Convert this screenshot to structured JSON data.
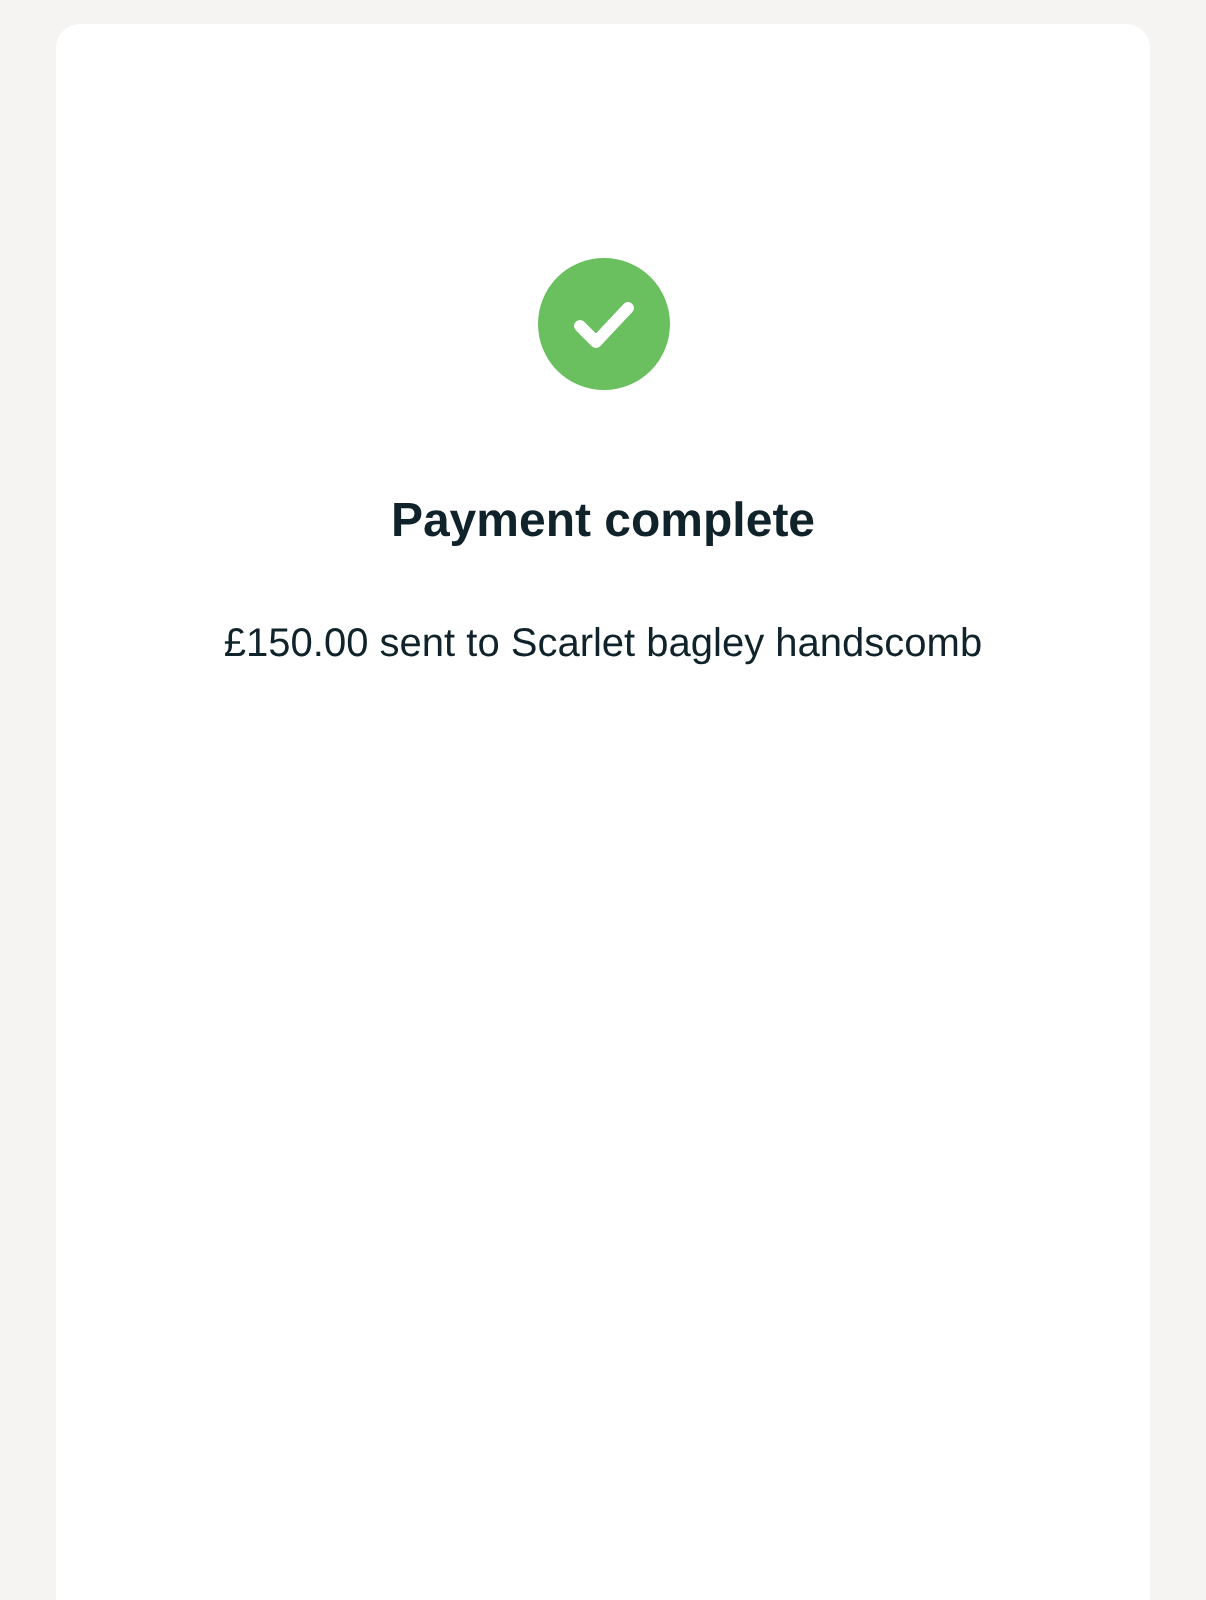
{
  "status": {
    "kind": "success",
    "title": "Payment complete",
    "message": "£150.00 sent to Scarlet bagley handscomb"
  }
}
